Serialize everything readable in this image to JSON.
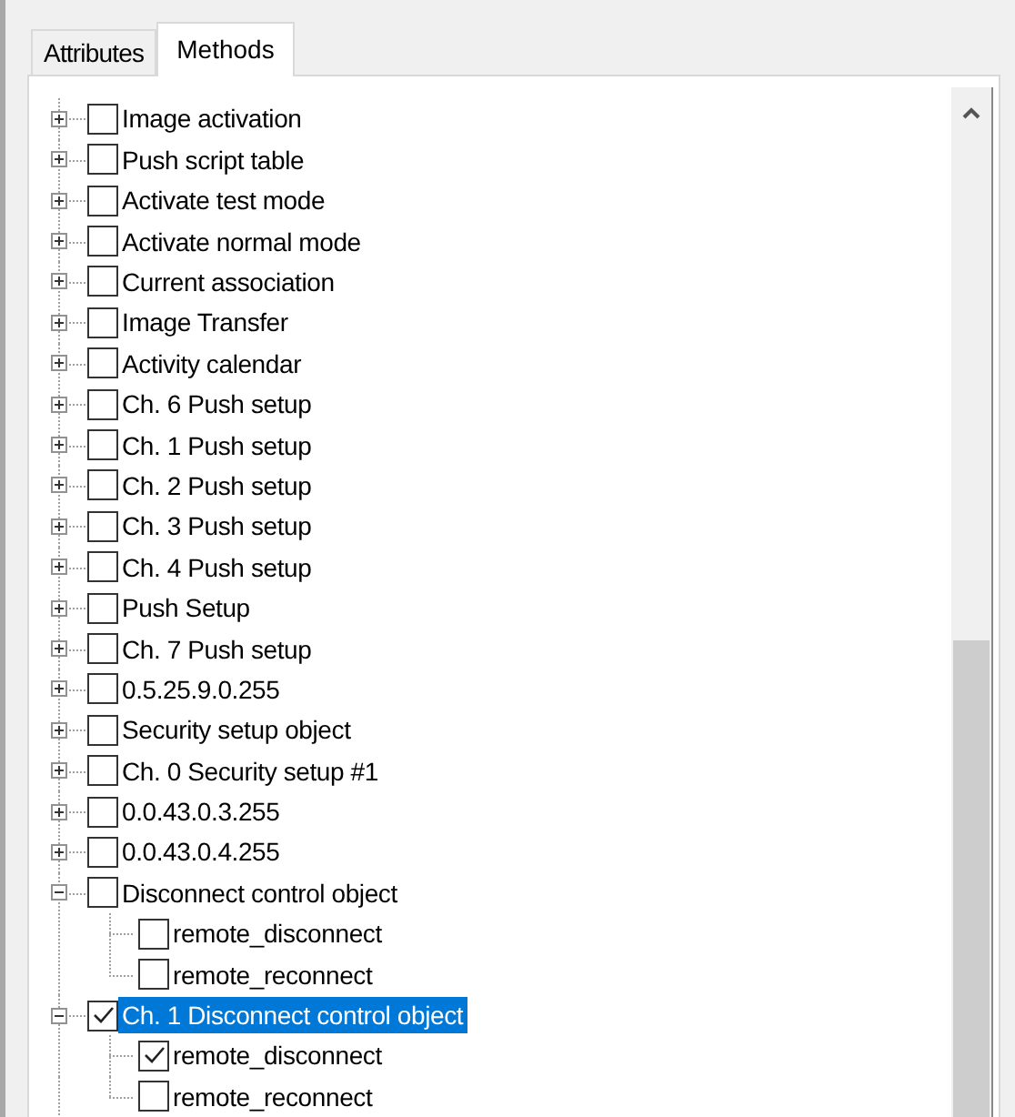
{
  "tabs": [
    {
      "label": "Attributes",
      "selected": false
    },
    {
      "label": "Methods",
      "selected": true
    }
  ],
  "tree": [
    {
      "label": "Image activation",
      "expanded": false,
      "checked": false,
      "selected": false
    },
    {
      "label": "Push script table",
      "expanded": false,
      "checked": false,
      "selected": false
    },
    {
      "label": "Activate test mode",
      "expanded": false,
      "checked": false,
      "selected": false
    },
    {
      "label": "Activate normal mode",
      "expanded": false,
      "checked": false,
      "selected": false
    },
    {
      "label": "Current association",
      "expanded": false,
      "checked": false,
      "selected": false
    },
    {
      "label": "Image Transfer",
      "expanded": false,
      "checked": false,
      "selected": false
    },
    {
      "label": "Activity calendar",
      "expanded": false,
      "checked": false,
      "selected": false
    },
    {
      "label": "Ch. 6 Push setup",
      "expanded": false,
      "checked": false,
      "selected": false
    },
    {
      "label": "Ch. 1 Push setup",
      "expanded": false,
      "checked": false,
      "selected": false
    },
    {
      "label": "Ch. 2 Push setup",
      "expanded": false,
      "checked": false,
      "selected": false
    },
    {
      "label": "Ch. 3 Push setup",
      "expanded": false,
      "checked": false,
      "selected": false
    },
    {
      "label": "Ch. 4 Push setup",
      "expanded": false,
      "checked": false,
      "selected": false
    },
    {
      "label": "Push Setup",
      "expanded": false,
      "checked": false,
      "selected": false
    },
    {
      "label": "Ch. 7 Push setup",
      "expanded": false,
      "checked": false,
      "selected": false
    },
    {
      "label": "0.5.25.9.0.255",
      "expanded": false,
      "checked": false,
      "selected": false
    },
    {
      "label": "Security setup object",
      "expanded": false,
      "checked": false,
      "selected": false
    },
    {
      "label": "Ch. 0 Security setup #1",
      "expanded": false,
      "checked": false,
      "selected": false
    },
    {
      "label": "0.0.43.0.3.255",
      "expanded": false,
      "checked": false,
      "selected": false
    },
    {
      "label": "0.0.43.0.4.255",
      "expanded": false,
      "checked": false,
      "selected": false
    },
    {
      "label": "Disconnect control object",
      "expanded": true,
      "checked": false,
      "selected": false,
      "children": [
        {
          "label": "remote_disconnect",
          "checked": false
        },
        {
          "label": "remote_reconnect",
          "checked": false
        }
      ]
    },
    {
      "label": "Ch. 1 Disconnect control object",
      "expanded": true,
      "checked": true,
      "selected": true,
      "children": [
        {
          "label": "remote_disconnect",
          "checked": true
        },
        {
          "label": "remote_reconnect",
          "checked": false
        }
      ]
    }
  ]
}
